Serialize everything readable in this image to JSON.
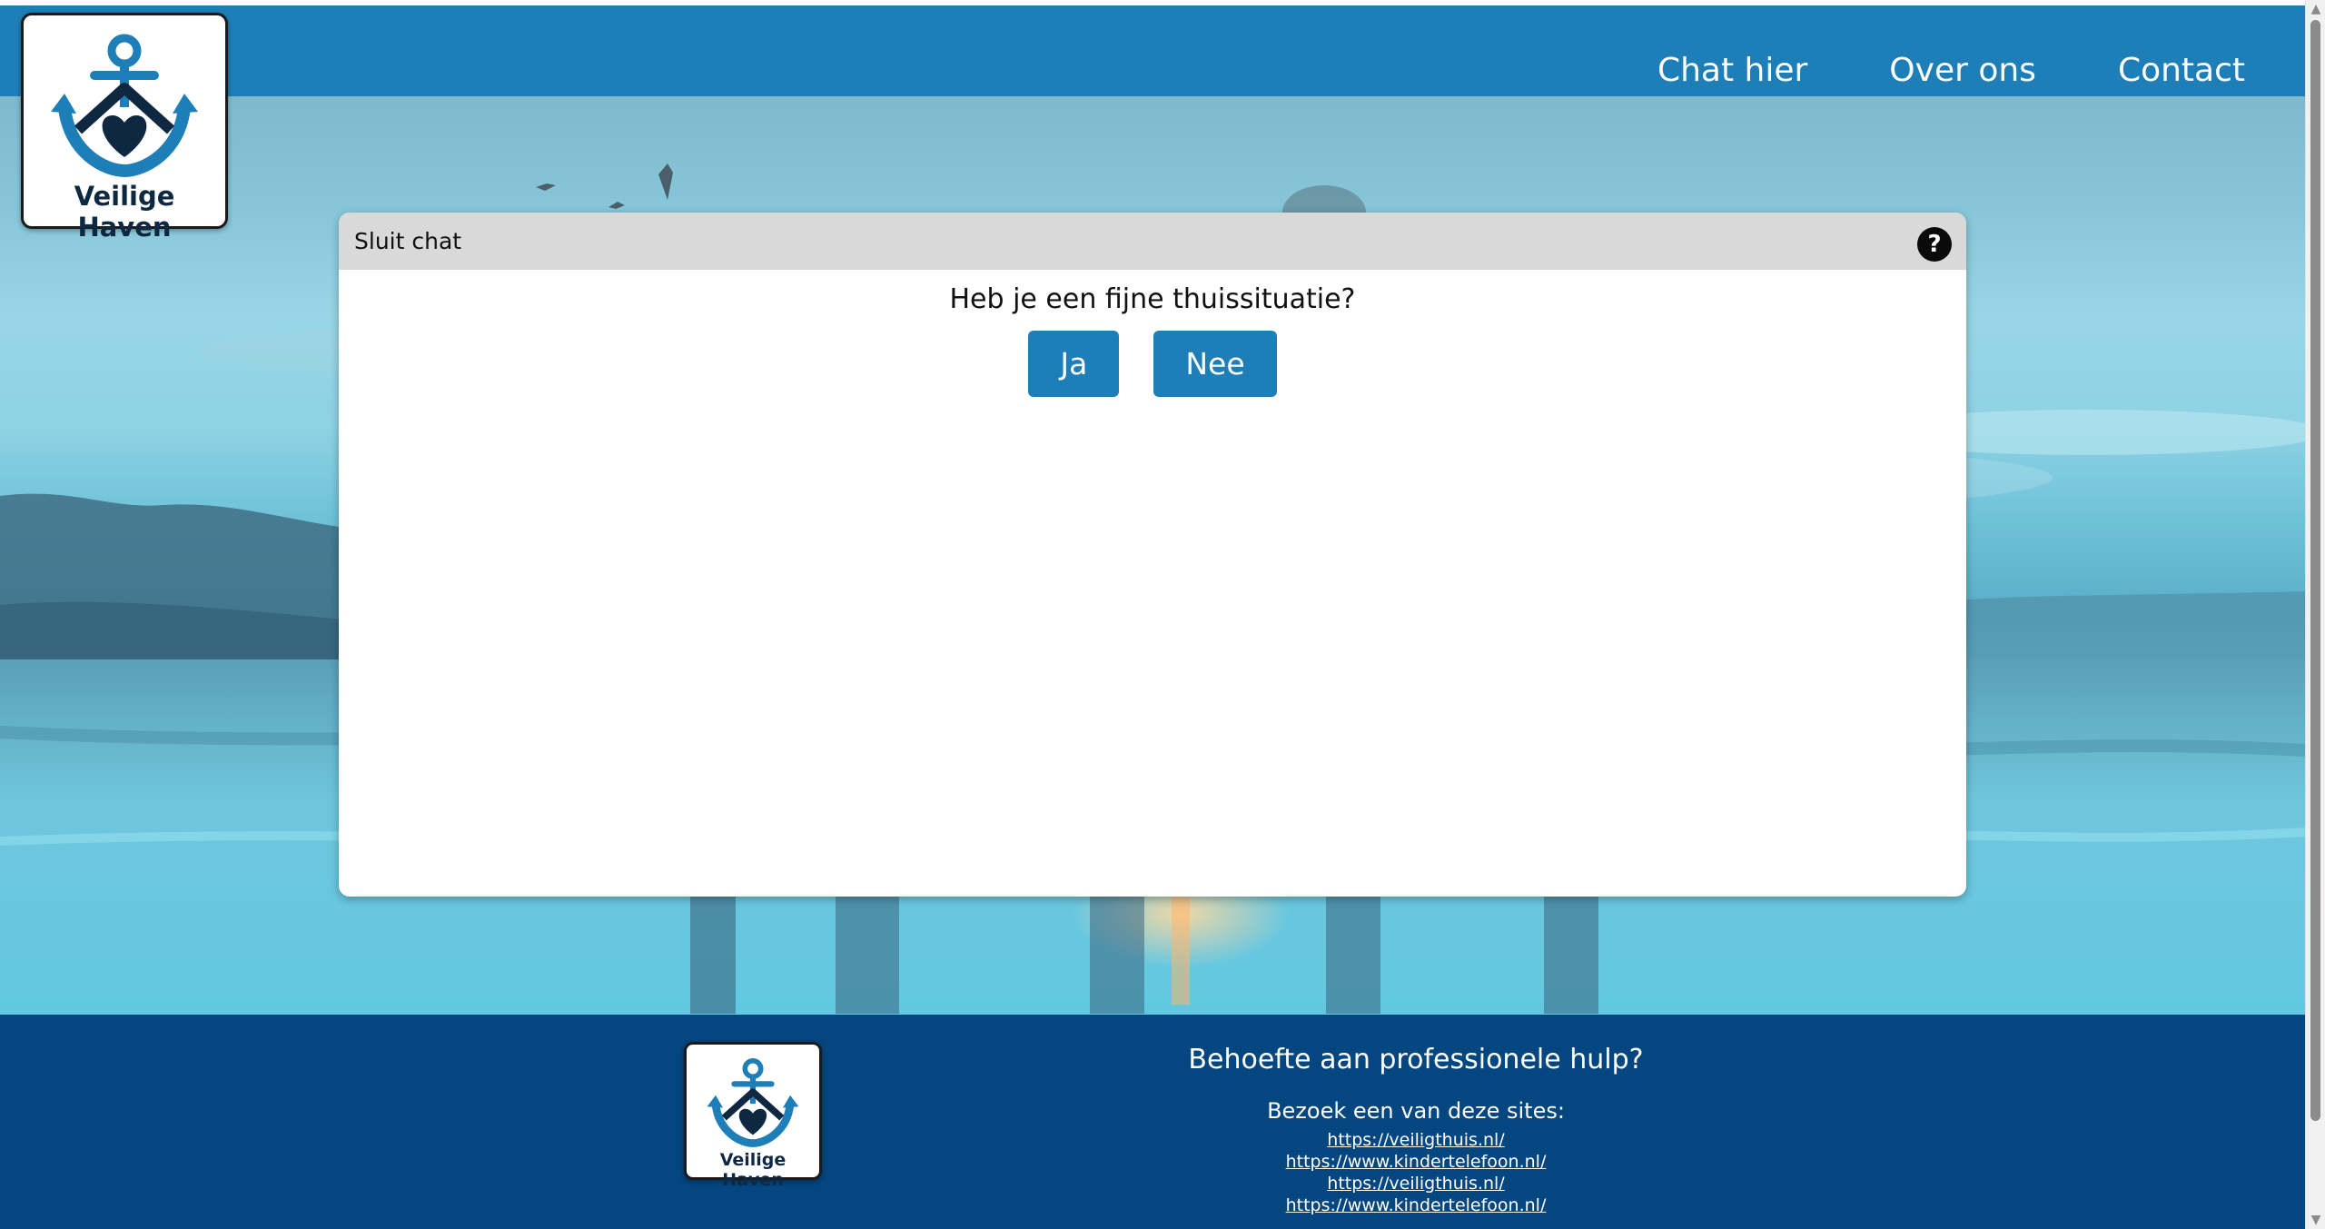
{
  "brand": {
    "name": "Veilige Haven",
    "primary_color": "#1e7fb8",
    "footer_color": "#04467f",
    "logo_icon": "anchor-house-heart-icon"
  },
  "nav": {
    "items": [
      {
        "label": "Chat hier"
      },
      {
        "label": "Over ons"
      },
      {
        "label": "Contact"
      }
    ]
  },
  "chat": {
    "close_label": "Sluit chat",
    "help_icon": "help-icon",
    "help_symbol": "?",
    "question": "Heb je een fijne thuissituatie?",
    "answers": [
      {
        "label": "Ja"
      },
      {
        "label": "Nee"
      }
    ]
  },
  "footer": {
    "help_title": "Behoefte aan professionele hulp?",
    "help_subtitle": "Bezoek een van deze sites:",
    "links": [
      "https://veiligthuis.nl/",
      "https://www.kindertelefoon.nl/",
      "https://veiligthuis.nl/",
      "https://www.kindertelefoon.nl/"
    ]
  }
}
